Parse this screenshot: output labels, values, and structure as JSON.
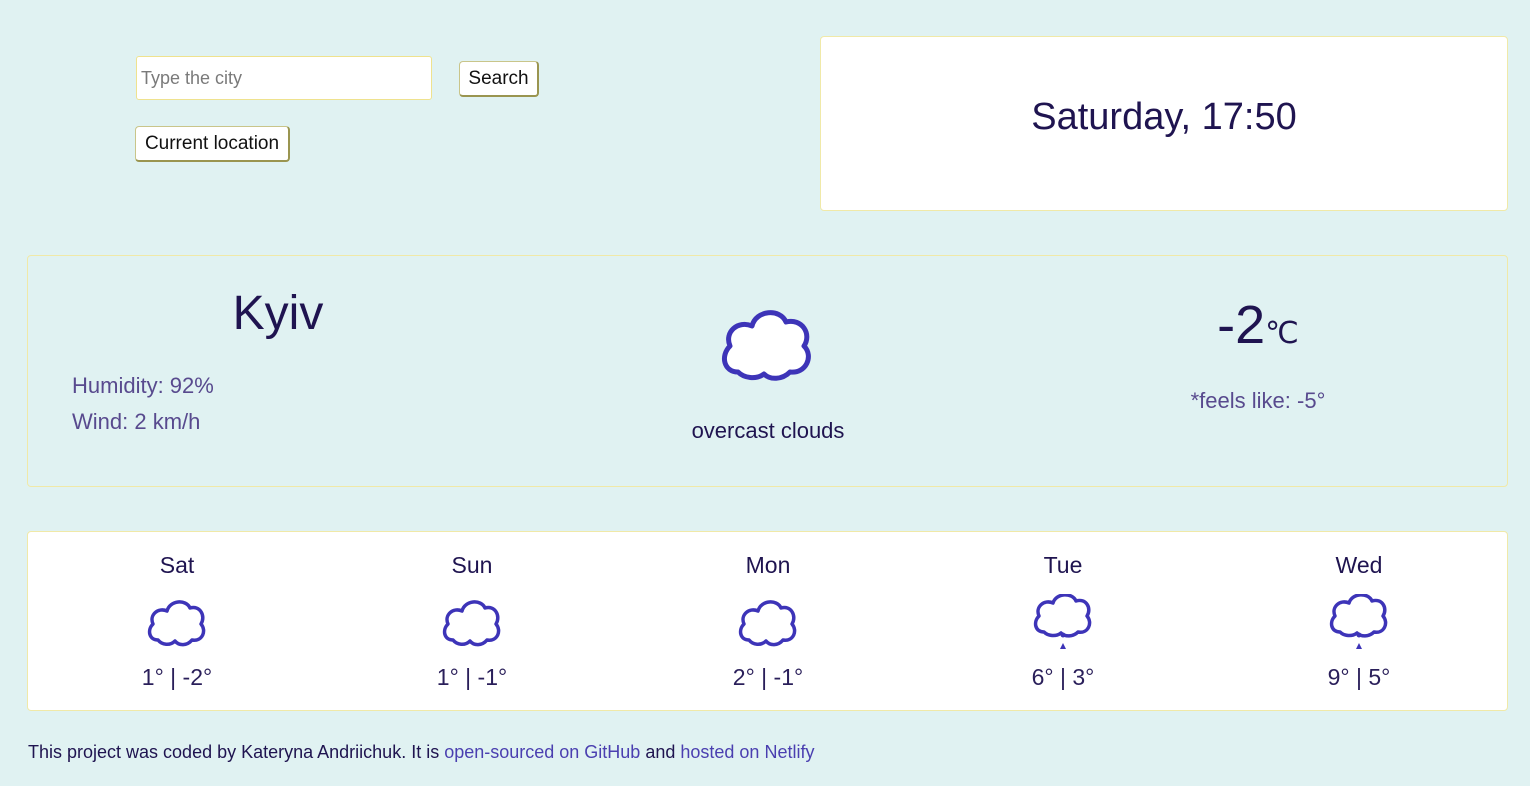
{
  "search": {
    "placeholder": "Type the city",
    "value": "",
    "search_label": "Search",
    "location_label": "Current location"
  },
  "datetime": {
    "text": "Saturday, 17:50"
  },
  "current": {
    "city": "Kyiv",
    "humidity": "Humidity: 92%",
    "wind": "Wind: 2 km/h",
    "icon": "cloud-icon",
    "description": "overcast clouds",
    "temperature": "-2",
    "unit": "℃",
    "feels_like": "*feels like: -5°"
  },
  "forecast": [
    {
      "day": "Sat",
      "icon": "cloud-icon",
      "temps": "1° | -2°"
    },
    {
      "day": "Sun",
      "icon": "cloud-icon",
      "temps": "1° | -1°"
    },
    {
      "day": "Mon",
      "icon": "cloud-icon",
      "temps": "2° | -1°"
    },
    {
      "day": "Tue",
      "icon": "rain-cloud-icon",
      "temps": "6° | 3°"
    },
    {
      "day": "Wed",
      "icon": "rain-cloud-icon",
      "temps": "9° | 5°"
    }
  ],
  "footer": {
    "text_before": "This project was coded by Kateryna Andriichuk. It is ",
    "github_link": "open-sourced on GitHub",
    "text_middle": " and ",
    "netlify_link": "hosted on Netlify"
  },
  "colors": {
    "background": "#e0f2f2",
    "panel_border": "#f0e9a8",
    "text_primary": "#1f1450",
    "text_secondary": "#584a8e",
    "icon_stroke": "#3d34b8",
    "link": "#4a3fb0"
  }
}
